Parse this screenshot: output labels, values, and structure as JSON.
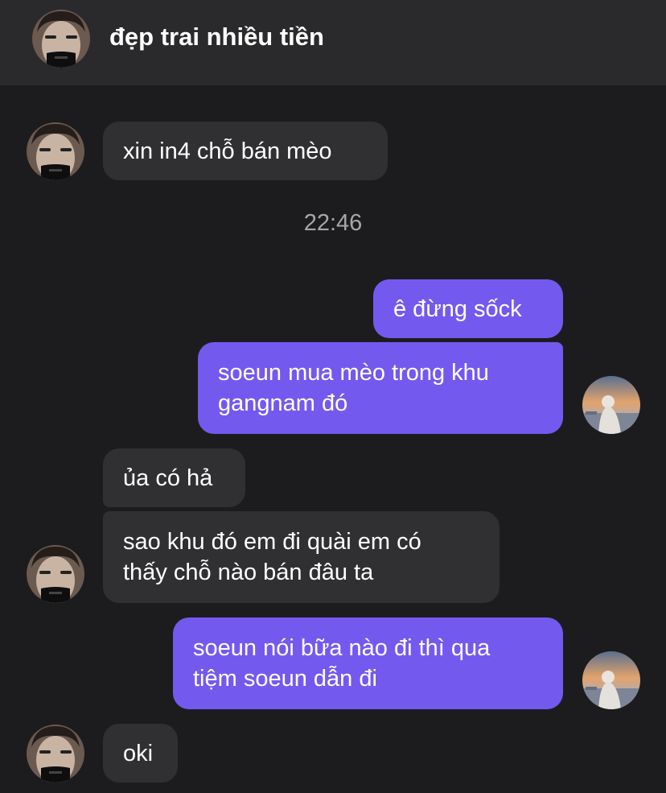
{
  "header": {
    "title": "đẹp trai nhiều tiền"
  },
  "messages": {
    "m1": {
      "lines": [
        "xin in4 chỗ bán mèo"
      ]
    },
    "timestamp": "22:46",
    "m2": {
      "lines": [
        "ê đừng sốck"
      ]
    },
    "m3": {
      "lines": [
        "soeun mua mèo trong khu",
        "gangnam đó"
      ]
    },
    "m4": {
      "lines": [
        "ủa có hả"
      ]
    },
    "m5": {
      "lines": [
        "sao khu đó em đi quài em có",
        "thấy chỗ nào bán đâu ta"
      ]
    },
    "m6": {
      "lines": [
        "soeun nói bữa nào đi thì qua",
        "tiệm soeun dẫn đi"
      ]
    },
    "m7": {
      "lines": [
        "oki"
      ]
    }
  },
  "colors": {
    "background": "#1c1c1e",
    "header": "#2a2a2c",
    "incoming_bubble": "#303033",
    "outgoing_bubble": "#7459ef",
    "timestamp": "#a6a6ab"
  },
  "icons": {
    "contact_avatar": "contact-avatar-icon",
    "self_avatar": "self-avatar-icon"
  }
}
